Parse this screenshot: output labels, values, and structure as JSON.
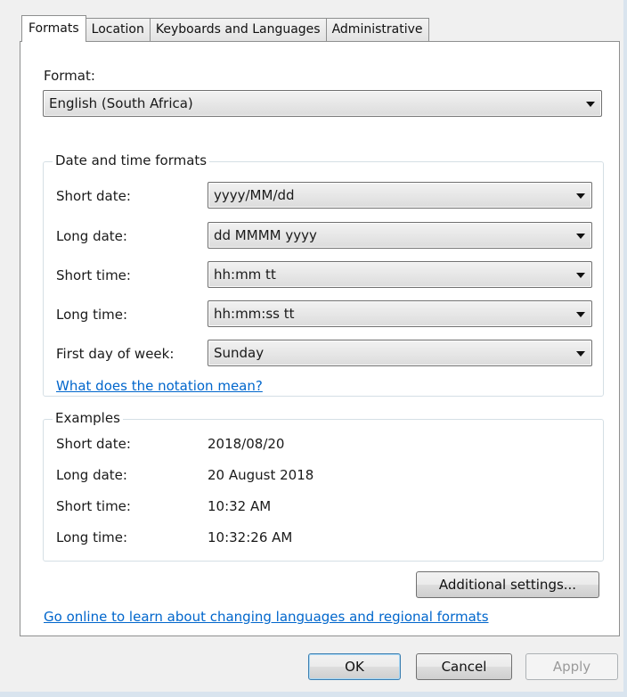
{
  "tabs": [
    {
      "label": "Formats",
      "active": true
    },
    {
      "label": "Location",
      "active": false
    },
    {
      "label": "Keyboards and Languages",
      "active": false
    },
    {
      "label": "Administrative",
      "active": false
    }
  ],
  "format": {
    "label": "Format:",
    "value": "English (South Africa)"
  },
  "datetime_group": {
    "title": "Date and time formats",
    "rows": [
      {
        "label": "Short date:",
        "value": "yyyy/MM/dd"
      },
      {
        "label": "Long date:",
        "value": "dd MMMM yyyy"
      },
      {
        "label": "Short time:",
        "value": "hh:mm tt"
      },
      {
        "label": "Long time:",
        "value": "hh:mm:ss tt"
      },
      {
        "label": "First day of week:",
        "value": "Sunday"
      }
    ],
    "notation_link": "What does the notation mean?"
  },
  "examples_group": {
    "title": "Examples",
    "rows": [
      {
        "label": "Short date:",
        "value": "2018/08/20"
      },
      {
        "label": "Long date:",
        "value": "20 August 2018"
      },
      {
        "label": "Short time:",
        "value": "10:32 AM"
      },
      {
        "label": "Long time:",
        "value": "10:32:26 AM"
      }
    ]
  },
  "additional_settings_label": "Additional settings...",
  "online_link": "Go online to learn about changing languages and regional formats",
  "buttons": {
    "ok": "OK",
    "cancel": "Cancel",
    "apply": "Apply"
  },
  "colors": {
    "link": "#0066cc",
    "window_bg": "#f0f0f0",
    "panel_bg": "#ffffff"
  }
}
